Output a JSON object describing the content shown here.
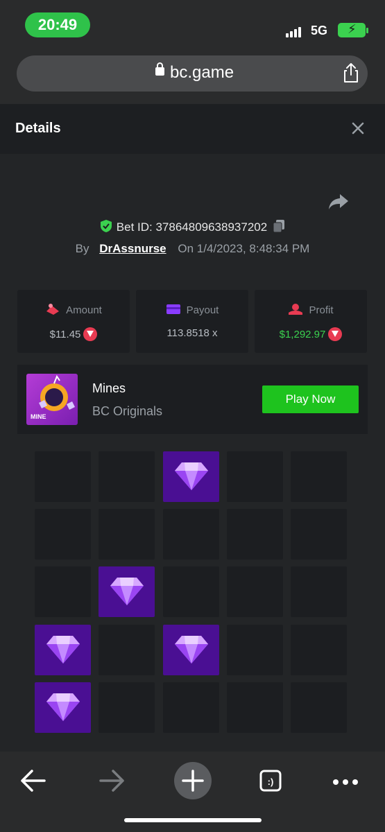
{
  "status_bar": {
    "time": "20:49",
    "network": "5G"
  },
  "browser": {
    "url": "bc.game"
  },
  "details": {
    "title": "Details"
  },
  "bet": {
    "id_label": "Bet ID: 37864809638937202",
    "by_label": "By",
    "username": "DrAssnurse",
    "on_label": "On",
    "datetime": "1/4/2023, 8:48:34 PM"
  },
  "stats": {
    "amount_label": "Amount",
    "amount_value": "$11.45",
    "payout_label": "Payout",
    "payout_value": "113.8518 x",
    "profit_label": "Profit",
    "profit_value": "$1,292.97"
  },
  "game": {
    "name": "Mines",
    "provider": "BC Originals",
    "thumb_label": "MINE",
    "play_label": "Play Now"
  },
  "colors": {
    "accent_green": "#1ec31e",
    "profit_green": "#3bd14f",
    "gem_tile": "#4a0f93",
    "coin_red": "#e83b52"
  },
  "grid": {
    "rows": 5,
    "cols": 5,
    "gems": [
      [
        0,
        2
      ],
      [
        2,
        1
      ],
      [
        3,
        0
      ],
      [
        3,
        2
      ],
      [
        4,
        0
      ]
    ]
  }
}
